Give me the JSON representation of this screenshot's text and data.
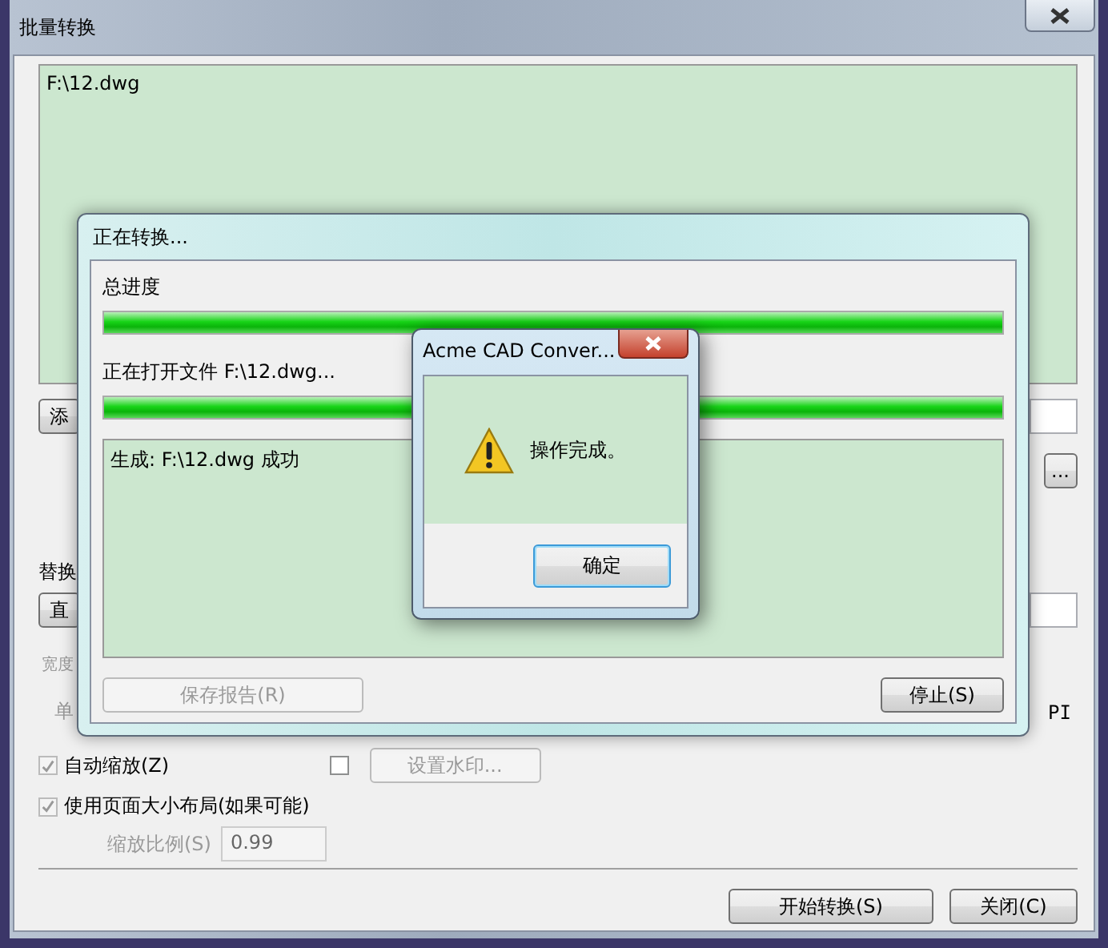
{
  "main_window": {
    "title": "批量转换",
    "files": [
      "F:\\12.dwg"
    ],
    "add_button": "添",
    "replace_label": "替换",
    "direct_button": "直",
    "width_label": "宽度",
    "unit_label": "单",
    "dpi_text": "PI",
    "browse_button": "...",
    "options": [
      {
        "label": "自动缩放(Z)",
        "checked": true,
        "disabled": true
      },
      {
        "label": "使用页面大小布局(如果可能)",
        "checked": true,
        "disabled": true
      }
    ],
    "watermark": {
      "checked": false,
      "button": "设置水印..."
    },
    "scale": {
      "label": "缩放比例(S)",
      "value": "0.99"
    },
    "buttons": [
      "开始转换(S)",
      "关闭(C)"
    ]
  },
  "progress_dialog": {
    "title": "正在转换...",
    "overall_label": "总进度",
    "overall": {
      "level": 1
    },
    "file_label": "正在打开文件 F:\\12.dwg...",
    "file": {
      "level": 1
    },
    "log": [
      "生成: F:\\12.dwg 成功"
    ],
    "save_button": {
      "label": "保存报告(R)",
      "disabled": true
    },
    "stop_button": "停止(S)"
  },
  "message_box": {
    "title": "Acme CAD Conver...",
    "message": "操作完成。",
    "ok_button": "确定"
  }
}
